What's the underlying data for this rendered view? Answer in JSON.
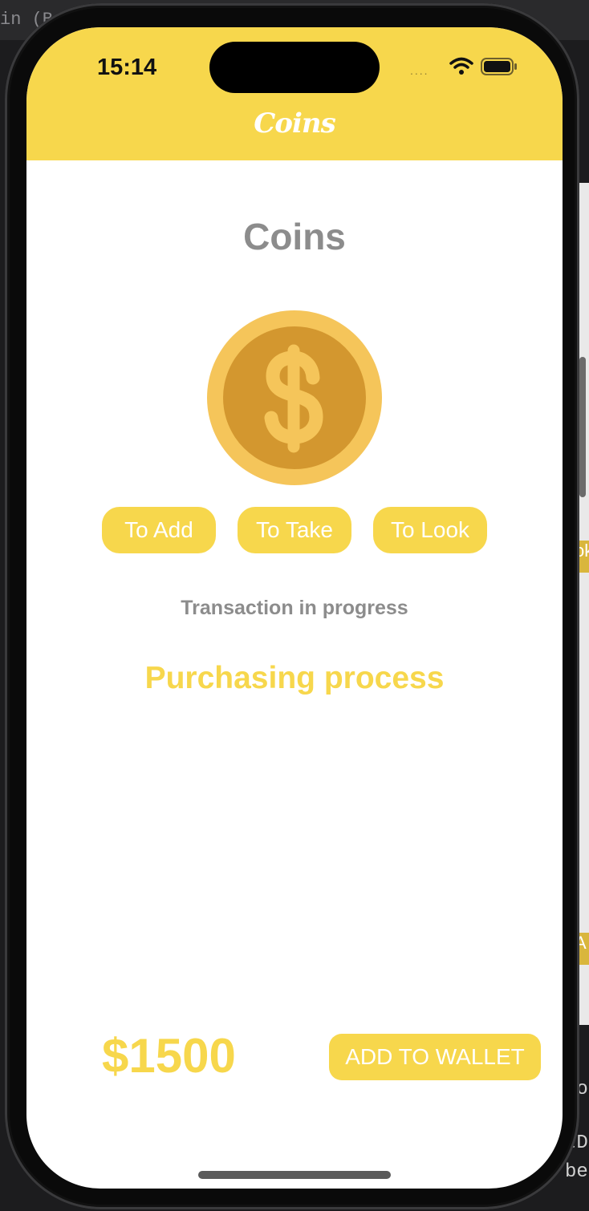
{
  "background": {
    "top_text": "in (B",
    "tab_marks": [
      "ok",
      "A"
    ],
    "code_lines": [
      "Fo",
      "tD",
      "be"
    ]
  },
  "status_bar": {
    "time": "15:14",
    "signal": "....",
    "icons": [
      "wifi-icon",
      "battery-icon"
    ]
  },
  "nav": {
    "title": "Coins"
  },
  "main": {
    "title": "Coins",
    "coin_icon": "dollar-coin-icon",
    "actions": [
      {
        "label": "To Add"
      },
      {
        "label": "To Take"
      },
      {
        "label": "To Look"
      }
    ],
    "status": "Transaction in progress",
    "process": "Purchasing process"
  },
  "footer": {
    "amount": "$1500",
    "button": "ADD TO WALLET"
  },
  "colors": {
    "accent": "#f7d74c",
    "text_gray": "#8c8c8c",
    "coin_outer": "#f5c55a",
    "coin_inner": "#d3972f"
  }
}
